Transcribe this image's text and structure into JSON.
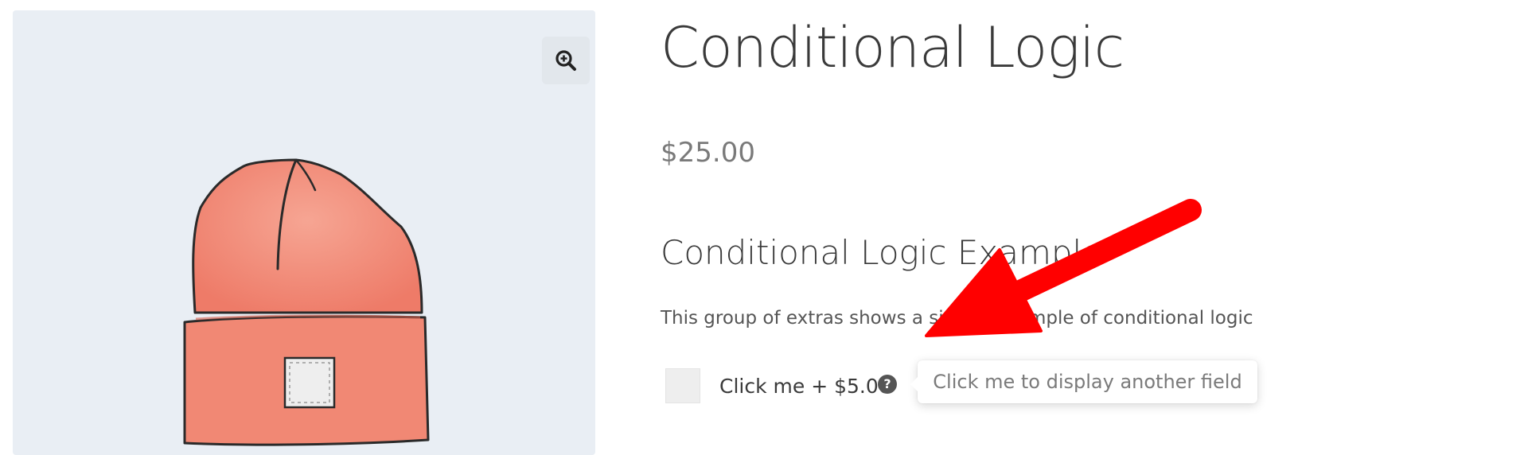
{
  "product": {
    "title": "Conditional Logic",
    "price": "$25.00",
    "image_alt": "Illustration of an orange knit beanie hat"
  },
  "gallery": {
    "zoom_icon": "zoom-in-icon",
    "background": "#e9eef4"
  },
  "extras": {
    "heading": "Conditional Logic Example",
    "description": "This group of extras shows a simple example of conditional logic",
    "field": {
      "label": "Click me + $5.00",
      "checked": false,
      "help_icon": "question-circle-icon",
      "tooltip": "Click me to display another field"
    }
  },
  "annotation": {
    "arrow_icon": "red-arrow",
    "color": "#ff0000"
  }
}
